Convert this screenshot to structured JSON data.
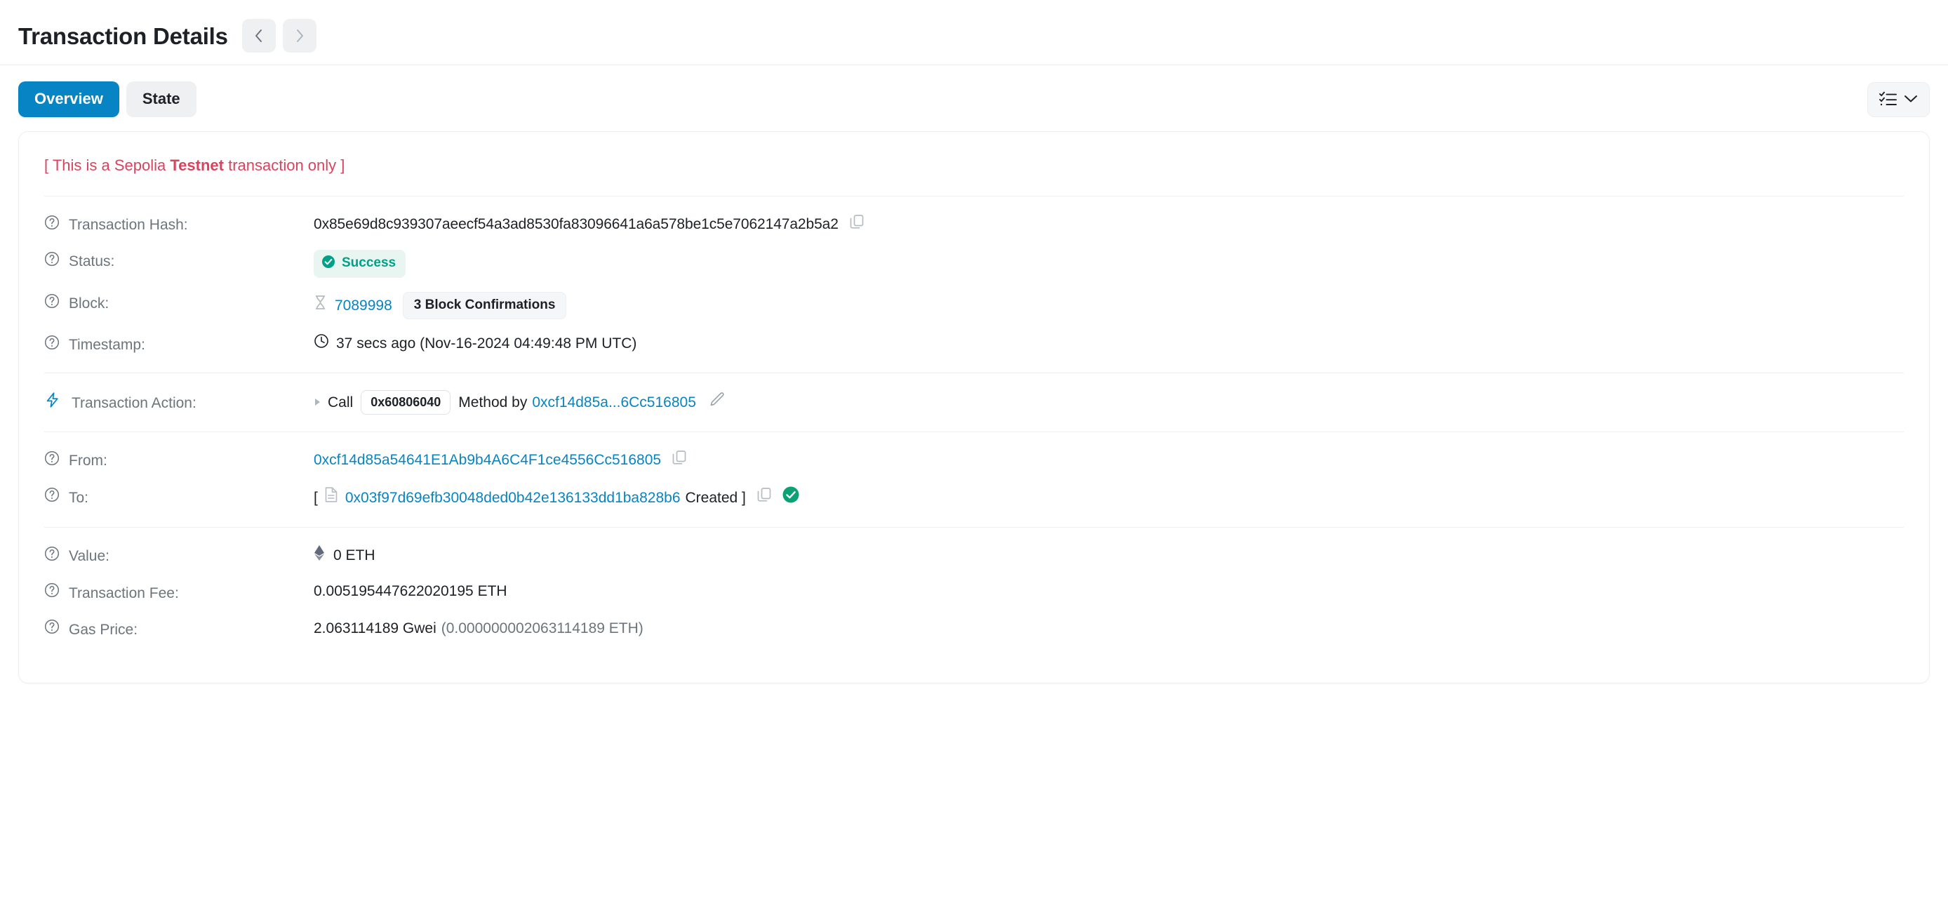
{
  "header": {
    "title": "Transaction Details",
    "prev_label": "Previous transaction",
    "next_label": "Next transaction"
  },
  "tabs": [
    {
      "label": "Overview",
      "active": true
    },
    {
      "label": "State",
      "active": false
    }
  ],
  "toolbar": {
    "list_toggle_label": "More options"
  },
  "notice": {
    "prefix": "[ This is a Sepolia ",
    "bold": "Testnet",
    "suffix": " transaction only ]"
  },
  "details": {
    "transaction_hash": {
      "label": "Transaction Hash:",
      "value": "0x85e69d8c939307aeecf54a3ad8530fa83096641a6a578be1c5e7062147a2b5a2",
      "copy_label": "Copy transaction hash"
    },
    "status": {
      "label": "Status:",
      "value": "Success"
    },
    "block": {
      "label": "Block:",
      "number": "7089998",
      "confirmations": "3 Block Confirmations"
    },
    "timestamp": {
      "label": "Timestamp:",
      "value": "37 secs ago (Nov-16-2024 04:49:48 PM UTC)"
    },
    "transaction_action": {
      "label": "Transaction Action:",
      "call_text": "Call",
      "method_chip": "0x60806040",
      "method_by_text": "Method by",
      "actor": "0xcf14d85a...6Cc516805"
    },
    "from": {
      "label": "From:",
      "value": "0xcf14d85a54641E1Ab9b4A6C4F1ce4556Cc516805",
      "copy_label": "Copy from address"
    },
    "to": {
      "label": "To:",
      "open_bracket": "[",
      "value": "0x03f97d69efb30048ded0b42e136133dd1ba828b6",
      "created_text": "Created ]",
      "copy_label": "Copy to address"
    },
    "value": {
      "label": "Value:",
      "amount": "0 ETH"
    },
    "transaction_fee": {
      "label": "Transaction Fee:",
      "value": "0.005195447622020195 ETH"
    },
    "gas_price": {
      "label": "Gas Price:",
      "gwei": "2.063114189 Gwei",
      "eth": "(0.000000002063114189 ETH)"
    }
  },
  "colors": {
    "accent_blue": "#0784c3",
    "success_green": "#00a186",
    "testnet_red": "#d9435e",
    "muted_grey": "#6c757d"
  },
  "icons": {
    "question": "question-mark-circle-icon",
    "bolt": "lightning-bolt-icon",
    "copy": "copy-icon",
    "hourglass": "hourglass-icon",
    "clock": "clock-icon",
    "ethereum": "ethereum-diamond-icon",
    "contract": "contract-document-icon",
    "verified": "verified-check-icon",
    "pencil": "pencil-edit-icon",
    "checklist": "checklist-icon",
    "chevron_down": "chevron-down-icon"
  }
}
